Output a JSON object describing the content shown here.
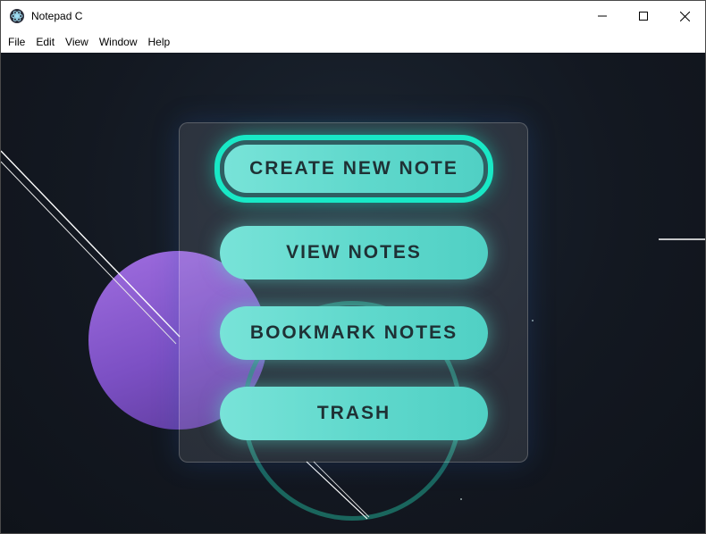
{
  "window": {
    "title": "Notepad C",
    "controls": [
      "minimize-icon",
      "maximize-icon",
      "close-icon"
    ]
  },
  "menubar": {
    "items": [
      "File",
      "Edit",
      "View",
      "Window",
      "Help"
    ]
  },
  "main_menu": {
    "buttons": [
      {
        "label": "CREATE NEW NOTE",
        "focused": true
      },
      {
        "label": "VIEW NOTES"
      },
      {
        "label": "BOOKMARK NOTES"
      },
      {
        "label": "TRASH"
      }
    ]
  },
  "colors": {
    "button_fill": "#5fd8cc",
    "focus_ring": "#19e8c6",
    "background": "#131821",
    "accent_circle": "#8a5ad4"
  }
}
